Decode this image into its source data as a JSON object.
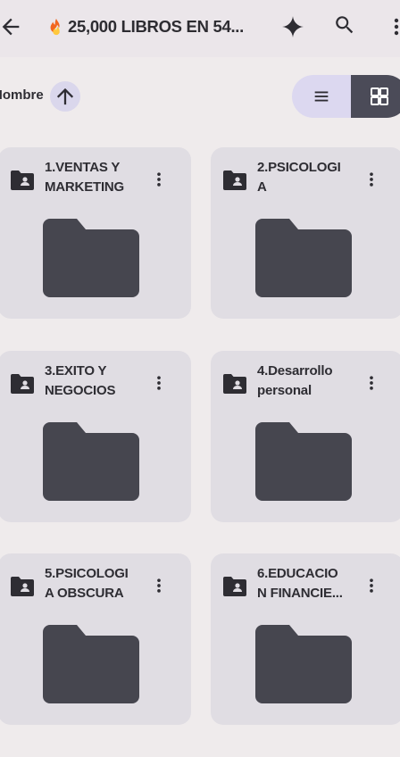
{
  "header": {
    "title": "25,000 LIBROS EN 54...",
    "back_icon": "arrow-left-icon",
    "fire_icon": "fire-emoji-icon",
    "sparkle_icon": "gemini-sparkle-icon",
    "search_icon": "search-icon",
    "more_icon": "more-vert-icon"
  },
  "sort": {
    "label": "Nombre",
    "direction_icon": "arrow-up-icon"
  },
  "view_toggle": {
    "list_icon": "list-view-icon",
    "grid_icon": "grid-view-icon",
    "selected": "grid"
  },
  "folders": [
    {
      "name": "1.VENTAS Y MARKETING"
    },
    {
      "name": "2.PSICOLOGIA"
    },
    {
      "name": "3.EXITO Y NEGOCIOS"
    },
    {
      "name": "4.Desarrollo personal"
    },
    {
      "name": "5.PSICOLOGIA OBSCURA"
    },
    {
      "name": "6.EDUCACION FINANCIE..."
    }
  ],
  "colors": {
    "background": "#efebec",
    "card": "#e0dde3",
    "folder_dark": "#46464f",
    "accent_light": "#dcd8f0"
  }
}
